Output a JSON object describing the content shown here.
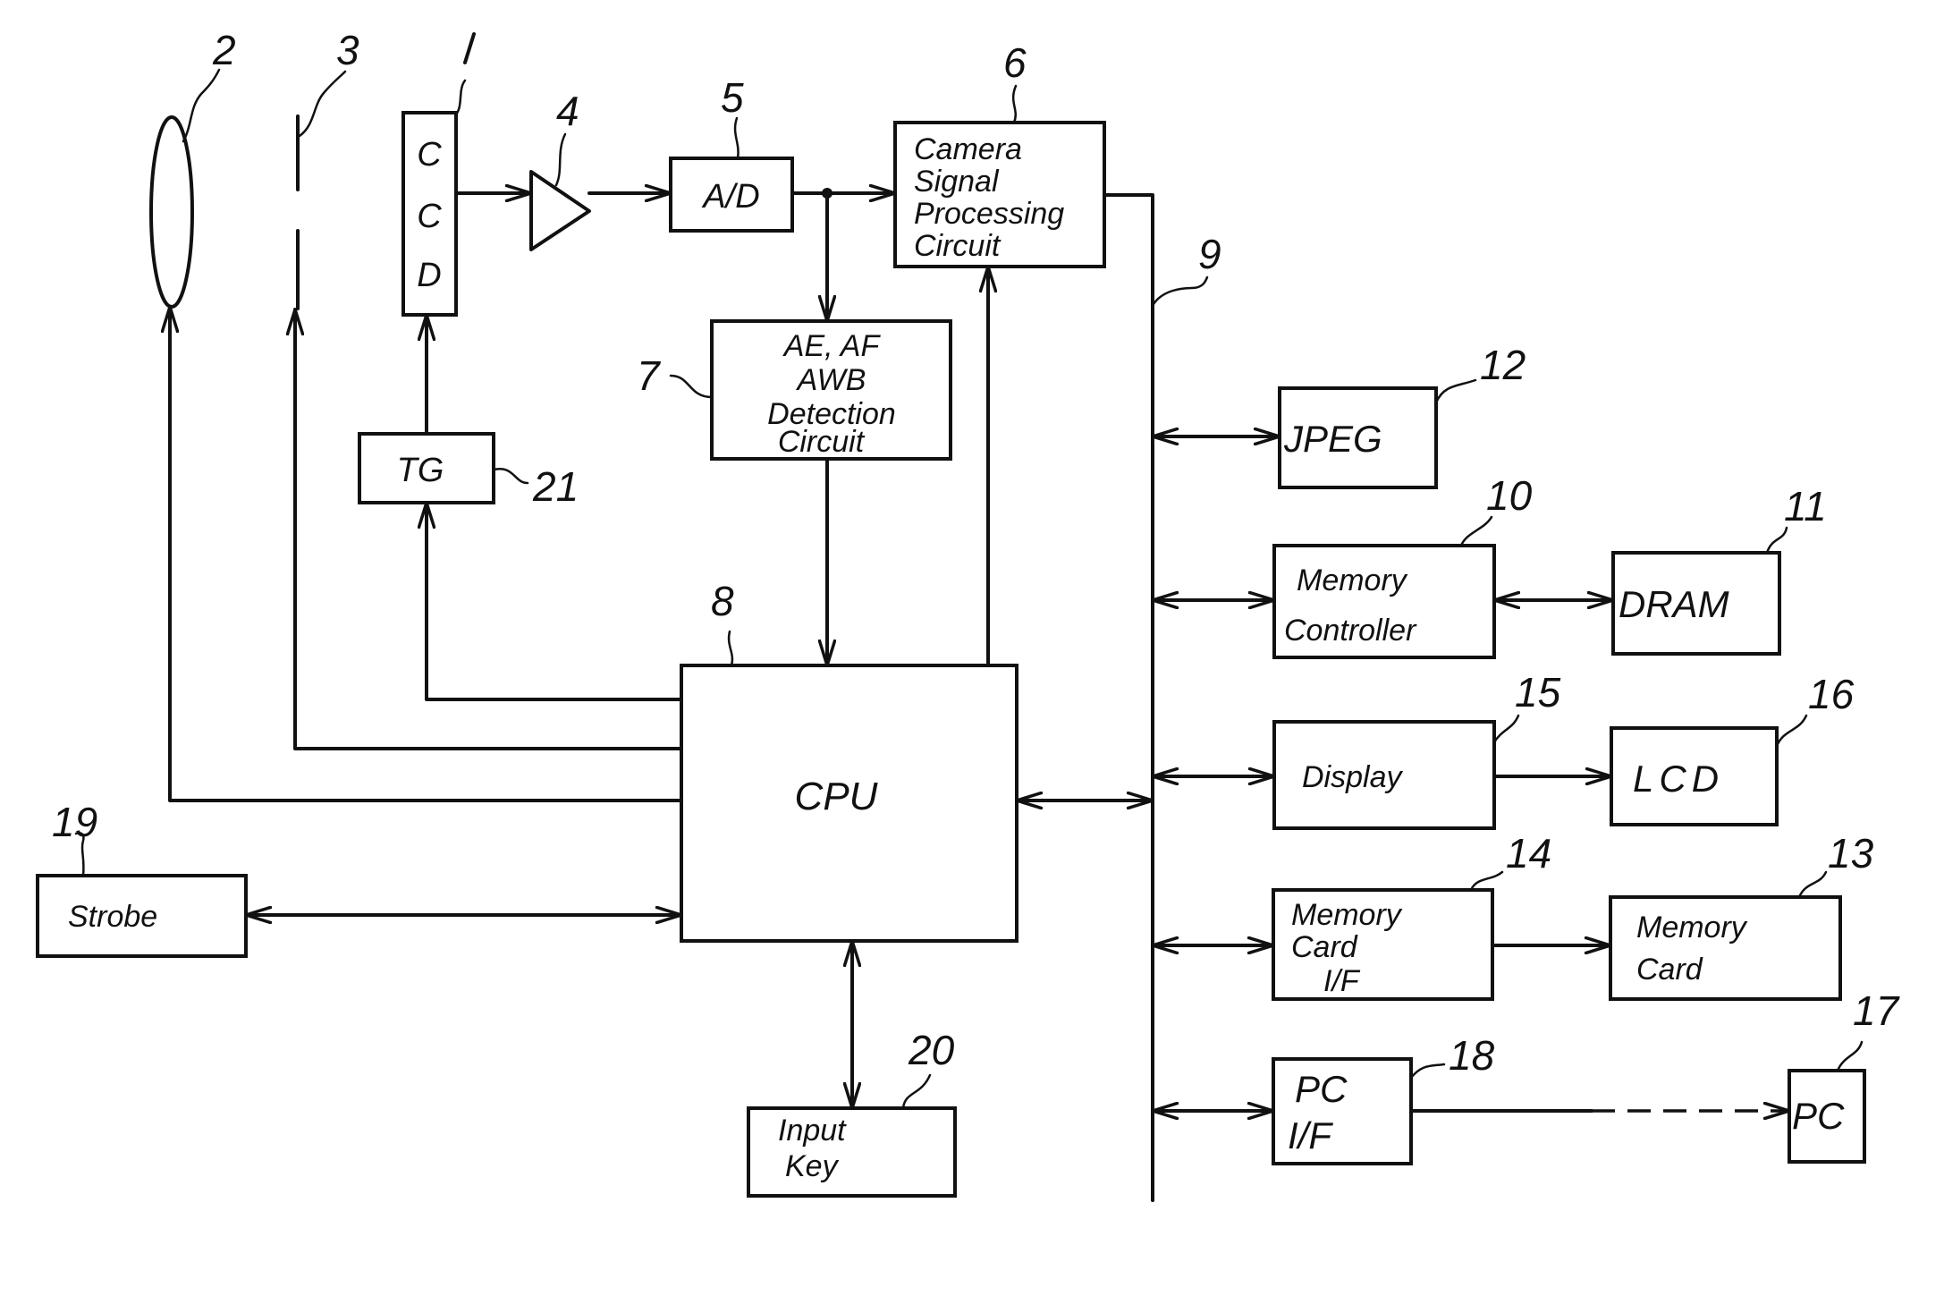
{
  "figure": {
    "blocks": {
      "ccd": {
        "ref": "1",
        "lines": [
          "C",
          "C",
          "D"
        ]
      },
      "lens": {
        "ref": "2"
      },
      "aperture": {
        "ref": "3"
      },
      "amplifier": {
        "ref": "4"
      },
      "ad": {
        "ref": "5",
        "lines": [
          "A/D"
        ]
      },
      "camera": {
        "ref": "6",
        "lines": [
          "Camera",
          "Signal",
          "Processing",
          "Circuit"
        ]
      },
      "detect": {
        "ref": "7",
        "lines": [
          "AE, AF",
          "AWB",
          "Detection",
          "Circuit"
        ]
      },
      "cpu": {
        "ref": "8",
        "lines": [
          "CPU"
        ]
      },
      "bus": {
        "ref": "9"
      },
      "memctrl": {
        "ref": "10",
        "lines": [
          "Memory",
          "Controller"
        ]
      },
      "dram": {
        "ref": "11",
        "lines": [
          "DRAM"
        ]
      },
      "jpeg": {
        "ref": "12",
        "lines": [
          "JPEG"
        ]
      },
      "memcard": {
        "ref": "13",
        "lines": [
          "Memory",
          "Card"
        ]
      },
      "mcif": {
        "ref": "14",
        "lines": [
          "Memory",
          "Card",
          "I/F"
        ]
      },
      "display": {
        "ref": "15",
        "lines": [
          "Display"
        ]
      },
      "lcd": {
        "ref": "16",
        "lines": [
          "LCD"
        ]
      },
      "pc": {
        "ref": "17",
        "lines": [
          "PC"
        ]
      },
      "pcif": {
        "ref": "18",
        "lines": [
          "PC",
          "I/F"
        ]
      },
      "strobe": {
        "ref": "19",
        "lines": [
          "Strobe"
        ]
      },
      "inputkey": {
        "ref": "20",
        "lines": [
          "Input",
          "Key"
        ]
      },
      "tg": {
        "ref": "21",
        "lines": [
          "TG"
        ]
      }
    }
  }
}
